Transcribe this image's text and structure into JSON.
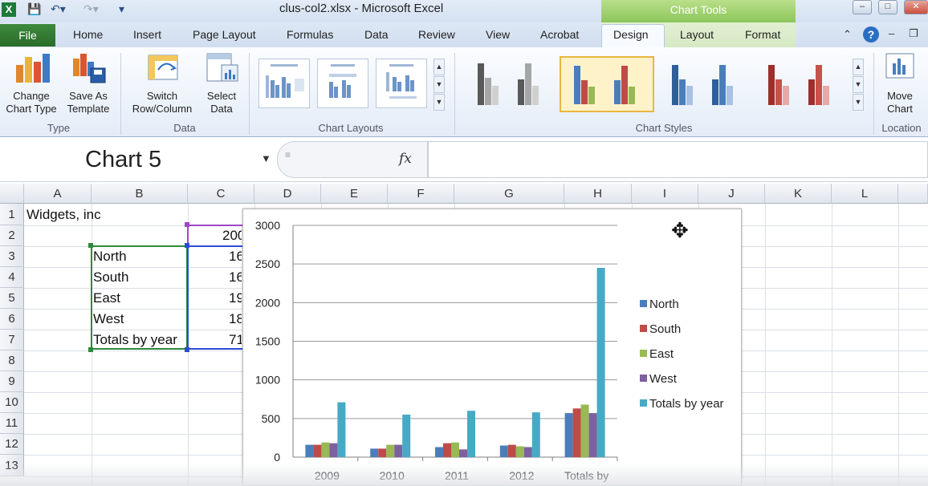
{
  "window": {
    "title": "clus-col2.xlsx - Microsoft Excel",
    "context_tab_group": "Chart Tools"
  },
  "tabs": [
    "File",
    "Home",
    "Insert",
    "Page Layout",
    "Formulas",
    "Data",
    "Review",
    "View",
    "Acrobat",
    "Design",
    "Layout",
    "Format"
  ],
  "active_tab": "Design",
  "ribbon": {
    "type_group": {
      "label": "Type",
      "change_chart_type": "Change\nChart Type",
      "save_as_template": "Save As\nTemplate"
    },
    "data_group": {
      "label": "Data",
      "switch_row_column": "Switch\nRow/Column",
      "select_data": "Select\nData"
    },
    "chart_layouts_group": {
      "label": "Chart Layouts"
    },
    "chart_styles_group": {
      "label": "Chart Styles",
      "selected_style_index": 1
    },
    "location_group": {
      "label": "Location",
      "move_chart": "Move\nChart"
    }
  },
  "formula_bar": {
    "name_box": "Chart 5",
    "fx_label": "fx",
    "formula": ""
  },
  "grid": {
    "columns": [
      "A",
      "B",
      "C",
      "D",
      "E",
      "F",
      "G",
      "H",
      "I",
      "J",
      "K",
      "L"
    ],
    "rows": [
      "1",
      "2",
      "3",
      "4",
      "5",
      "6",
      "7",
      "8",
      "9",
      "10",
      "11",
      "12",
      "13"
    ],
    "cells": {
      "A1": "Widgets, inc",
      "C2": "200",
      "B3": "North",
      "C3": "16",
      "B4": "South",
      "C4": "16",
      "B5": "East",
      "C5": "19",
      "B6": "West",
      "C6": "18",
      "B7": "Totals by year",
      "C7": "71"
    }
  },
  "chart_data": {
    "type": "bar",
    "categories": [
      "2009",
      "2010",
      "2011",
      "2012",
      "Totals by"
    ],
    "series": [
      {
        "name": "North",
        "values": [
          160,
          110,
          130,
          150,
          570
        ]
      },
      {
        "name": "South",
        "values": [
          160,
          110,
          180,
          160,
          630
        ]
      },
      {
        "name": "East",
        "values": [
          190,
          160,
          190,
          140,
          680
        ]
      },
      {
        "name": "West",
        "values": [
          180,
          160,
          100,
          130,
          570
        ]
      },
      {
        "name": "Totals by year",
        "values": [
          710,
          550,
          600,
          580,
          2450
        ]
      }
    ],
    "colors": [
      "#4a7ebb",
      "#be4b48",
      "#98b954",
      "#7d60a0",
      "#46aac5"
    ],
    "yticks": [
      "3000",
      "2500",
      "2000",
      "1500",
      "1000",
      "500",
      "0"
    ],
    "ylim": [
      0,
      3000
    ],
    "grid": true,
    "legend_position": "right"
  }
}
